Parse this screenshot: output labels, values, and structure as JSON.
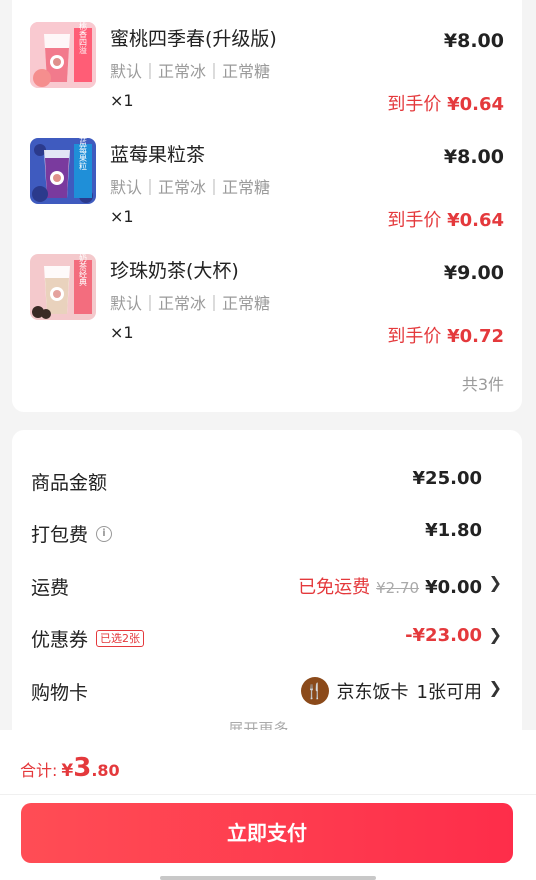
{
  "items": [
    {
      "name": "蜜桃四季春(升级版)",
      "spec": "默认｜正常冰｜正常糖",
      "qty": "×1",
      "price": "¥8.00",
      "final_label": "到手价 ",
      "final_price": "¥0.64",
      "thumb_text": "桃香四溢",
      "thumb_color": "#f4a7b2"
    },
    {
      "name": "蓝莓果粒茶",
      "spec": "默认｜正常冰｜正常糖",
      "qty": "×1",
      "price": "¥8.00",
      "final_label": "到手价 ",
      "final_price": "¥0.64",
      "thumb_text": "蓝莓果粒",
      "thumb_color": "#5a6fc8"
    },
    {
      "name": "珍珠奶茶(大杯)",
      "spec": "默认｜正常冰｜正常糖",
      "qty": "×1",
      "price": "¥9.00",
      "final_label": "到手价 ",
      "final_price": "¥0.72",
      "thumb_text": "奶茶经典",
      "thumb_color": "#f1c4c8"
    }
  ],
  "total_count": "共3件",
  "fees": {
    "goods": {
      "label": "商品金额",
      "value": "¥25.00"
    },
    "packing": {
      "label": "打包费",
      "value": "¥1.80"
    },
    "shipping": {
      "label": "运费",
      "free_text": "已免运费",
      "original": "¥2.70",
      "value": "¥0.00"
    },
    "coupon": {
      "label": "优惠券",
      "tag": "已选2张",
      "value": "-¥23.00"
    },
    "card": {
      "label": "购物卡",
      "card_name": "京东饭卡",
      "available": "1张可用"
    }
  },
  "expand_more": "展开更多",
  "summary": {
    "label": "合计:",
    "yen": "¥",
    "int": "3",
    "dec": ".80"
  },
  "pay_button": "立即支付",
  "colors": {
    "accent": "#e4393c",
    "button": "#fe2d4a"
  }
}
